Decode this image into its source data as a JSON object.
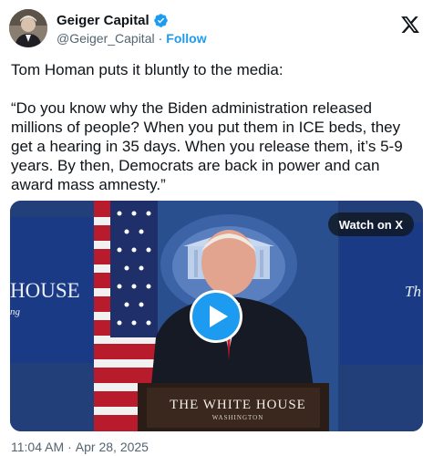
{
  "author": {
    "display_name": "Geiger Capital",
    "handle": "@Geiger_Capital",
    "separator": "·",
    "follow_label": "Follow",
    "verified_color": "#1d9bf0"
  },
  "icons": {
    "verified": "verified-badge-icon",
    "platform": "x-logo-icon",
    "play": "play-icon"
  },
  "tweet": {
    "line1": "Tom Homan puts it bluntly to the media:",
    "quote": "“Do you know why the Biden administration released millions of people? When you put them in ICE beds, they get a hearing in 35 days. When you release them, it’s 5-9 years. By then, Democrats are back in power and can award mass amnesty.”"
  },
  "media": {
    "watch_label": "Watch on X",
    "podium_title": "THE WHITE HOUSE",
    "podium_subtitle": "WASHINGTON",
    "bg_left_text": "HOUSE",
    "bg_left_sub": "ng",
    "bg_right_text": "Th"
  },
  "timestamp": {
    "time": "11:04 AM",
    "separator": "·",
    "date": "Apr 28, 2025"
  },
  "colors": {
    "accent": "#1d9bf0",
    "secondary_text": "#536471",
    "primary_text": "#0f1419"
  }
}
